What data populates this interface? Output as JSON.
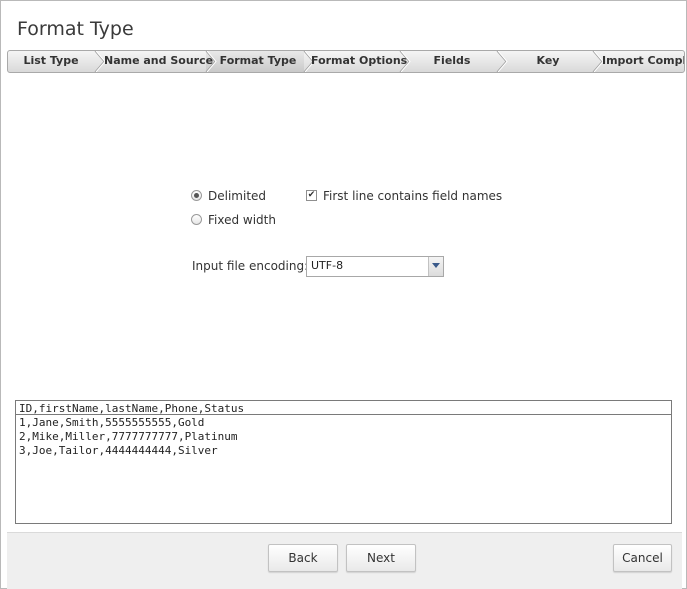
{
  "dialog": {
    "title": "Format Type"
  },
  "wizard": {
    "steps": [
      {
        "label": "List Type",
        "active": false
      },
      {
        "label": "Name and Source",
        "active": false
      },
      {
        "label": "Format Type",
        "active": true
      },
      {
        "label": "Format Options",
        "active": false
      },
      {
        "label": "Fields",
        "active": false
      },
      {
        "label": "Key",
        "active": false
      },
      {
        "label": "Import Complete",
        "active": false
      }
    ]
  },
  "format": {
    "delimited_label": "Delimited",
    "delimited_selected": true,
    "fixed_width_label": "Fixed width",
    "fixed_width_selected": false,
    "first_line_label": "First line contains field names",
    "first_line_checked": true,
    "encoding_label": "Input file encoding:",
    "encoding_value": "UTF-8"
  },
  "preview": {
    "header": "ID,firstName,lastName,Phone,Status",
    "lines": [
      "1,Jane,Smith,5555555555,Gold",
      "2,Mike,Miller,7777777777,Platinum",
      "3,Joe,Tailor,4444444444,Silver"
    ]
  },
  "footer": {
    "back_label": "Back",
    "next_label": "Next",
    "cancel_label": "Cancel"
  }
}
